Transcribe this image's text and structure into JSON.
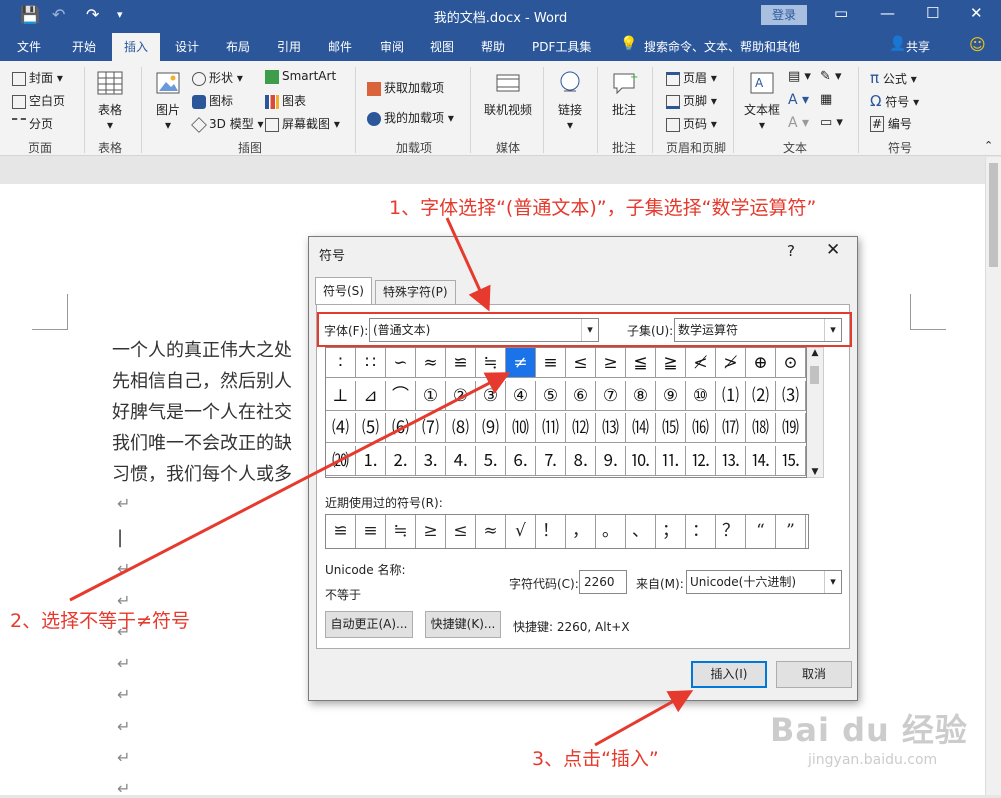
{
  "title_bar": {
    "title": "我的文档.docx - Word",
    "login": "登录"
  },
  "tabs": [
    "文件",
    "开始",
    "插入",
    "设计",
    "布局",
    "引用",
    "邮件",
    "审阅",
    "视图",
    "帮助",
    "PDF工具集"
  ],
  "search_placeholder": "搜索命令、文本、帮助和其他",
  "share": "共享",
  "ribbon": {
    "pages": {
      "cover": "封面",
      "blank": "空白页",
      "break": "分页",
      "group": "页面"
    },
    "table": {
      "label": "表格",
      "group": "表格"
    },
    "illustrations": {
      "picture": "图片",
      "shapes": "形状",
      "icons": "图标",
      "model3d": "3D 模型",
      "smartart": "SmartArt",
      "chart": "图表",
      "screenshot": "屏幕截图",
      "group": "插图"
    },
    "addins": {
      "get": "获取加载项",
      "mine": "我的加载项",
      "group": "加载项"
    },
    "media": {
      "video": "联机视频",
      "group": "媒体"
    },
    "links": {
      "link": "链接"
    },
    "comments": {
      "comment": "批注",
      "group": "批注"
    },
    "header_footer": {
      "header": "页眉",
      "footer": "页脚",
      "page_number": "页码",
      "group": "页眉和页脚"
    },
    "text": {
      "textbox": "文本框",
      "group": "文本"
    },
    "symbols": {
      "equation": "公式",
      "symbol": "符号",
      "number": "编号",
      "group": "符号"
    }
  },
  "document": {
    "lines": [
      "一个人的真正伟大之处",
      "先相信自己，然后别人",
      "好脾气是一个人在社交",
      "我们唯一不会改正的缺",
      "习惯，我们每个人或多"
    ]
  },
  "dialog": {
    "title": "符号",
    "help": "?",
    "close": "✕",
    "tab_symbols": "符号(S)",
    "tab_special": "特殊字符(P)",
    "font_label": "字体(F):",
    "font_value": "(普通文本)",
    "subset_label": "子集(U):",
    "subset_value": "数学运算符",
    "symbols": [
      "∶",
      "∷",
      "∽",
      "≈",
      "≌",
      "≒",
      "≠",
      "≡",
      "≤",
      "≥",
      "≦",
      "≧",
      "≮",
      "≯",
      "⊕",
      "⊙",
      "⊥",
      "⊿",
      "⌒",
      "①",
      "②",
      "③",
      "④",
      "⑤",
      "⑥",
      "⑦",
      "⑧",
      "⑨",
      "⑩",
      "⑴",
      "⑵",
      "⑶",
      "⑷",
      "⑸",
      "⑹",
      "⑺",
      "⑻",
      "⑼",
      "⑽",
      "⑾",
      "⑿",
      "⒀",
      "⒁",
      "⒂",
      "⒃",
      "⒄",
      "⒅",
      "⒆",
      "⒇",
      "⒈",
      "⒉",
      "⒊",
      "⒋",
      "⒌",
      "⒍",
      "⒎",
      "⒏",
      "⒐",
      "⒑",
      "⒒",
      "⒓",
      "⒔",
      "⒕",
      "⒖"
    ],
    "recent_label": "近期使用过的符号(R):",
    "recent": [
      "≌",
      "≡",
      "≒",
      "≥",
      "≤",
      "≈",
      "√",
      "！",
      "，",
      "。",
      "、",
      "；",
      "：",
      "？",
      "“",
      "”"
    ],
    "unicode_name_label": "Unicode 名称:",
    "unicode_name": "不等于",
    "char_code_label": "字符代码(C):",
    "char_code": "2260",
    "from_label": "来自(M):",
    "from_value": "Unicode(十六进制)",
    "autocorrect": "自动更正(A)...",
    "shortcut_key": "快捷键(K)...",
    "shortcut_text": "快捷键: 2260, Alt+X",
    "insert": "插入(I)",
    "cancel": "取消"
  },
  "annotations": {
    "step1": "1、字体选择“(普通文本)”，子集选择“数学运算符”",
    "step2": "2、选择不等于≠符号",
    "step3": "3、点击“插入”"
  },
  "watermark": {
    "brand": "Bai du 经验",
    "url": "jingyan.baidu.com"
  },
  "colors": {
    "accent": "#2b579a",
    "annotation": "#e53a2d",
    "selected_cell": "#1a73e8"
  }
}
